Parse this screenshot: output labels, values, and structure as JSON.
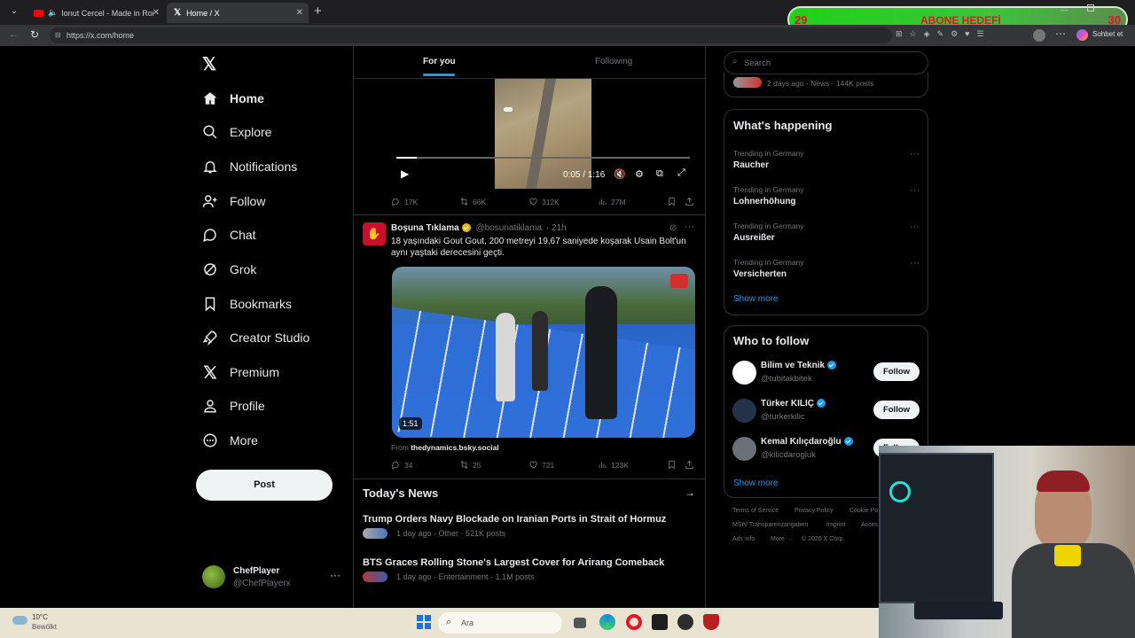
{
  "browser": {
    "tabs": [
      {
        "title": "Ionut Cercel - Made in Roman"
      },
      {
        "title": "Home / X"
      }
    ],
    "url": "https://x.com/home"
  },
  "overlay": {
    "count_left": "29",
    "title": "ABONE HEDEFİ",
    "count_right": "30",
    "chat_label": "Sohbet et"
  },
  "sidebar": {
    "items": [
      {
        "label": "Home",
        "icon": "home-icon"
      },
      {
        "label": "Explore",
        "icon": "search-icon"
      },
      {
        "label": "Notifications",
        "icon": "bell-icon"
      },
      {
        "label": "Follow",
        "icon": "person-plus-icon"
      },
      {
        "label": "Chat",
        "icon": "chat-icon"
      },
      {
        "label": "Grok",
        "icon": "grok-icon"
      },
      {
        "label": "Bookmarks",
        "icon": "bookmark-icon"
      },
      {
        "label": "Creator Studio",
        "icon": "rocket-icon"
      },
      {
        "label": "Premium",
        "icon": "x-logo-icon"
      },
      {
        "label": "Profile",
        "icon": "person-icon"
      },
      {
        "label": "More",
        "icon": "more-circle-icon"
      }
    ],
    "post_label": "Post",
    "account": {
      "name": "ChefPlayer",
      "handle": "@ChefPlayerx"
    }
  },
  "timeline": {
    "tabs": [
      "For you",
      "Following"
    ],
    "video1": {
      "time": "0:05 / 1:16"
    },
    "tweet1_stats": {
      "replies": "17K",
      "reposts": "66K",
      "likes": "312K",
      "views": "27M"
    },
    "tweet2": {
      "name": "Boşuna Tıklama",
      "handle": "@bosunatiklama",
      "time": "· 21h",
      "text": "18 yaşındaki Gout Gout, 200 metreyi 19,67 saniyede koşarak Usain Bolt'un aynı yaştaki derecesini geçti.",
      "duration": "1:51",
      "source_prefix": "From",
      "source": "thedynamics.bsky.social",
      "stats": {
        "replies": "34",
        "reposts": "25",
        "likes": "721",
        "views": "123K"
      }
    },
    "news": {
      "heading": "Today's News",
      "items": [
        {
          "title": "Trump Orders Navy Blockade on Iranian Ports in Strait of Hormuz",
          "meta": "1 day ago · Other · 521K posts"
        },
        {
          "title": "BTS Graces Rolling Stone's Largest Cover for Arirang Comeback",
          "meta": "1 day ago · Entertainment · 1.1M posts"
        }
      ]
    }
  },
  "right": {
    "search_placeholder": "Search",
    "top_meta": "2 days ago · News · 144K posts",
    "happening": {
      "title": "What's happening",
      "trends": [
        {
          "meta": "Trending in Germany",
          "name": "Raucher"
        },
        {
          "meta": "Trending in Germany",
          "name": "Lohnerhöhung"
        },
        {
          "meta": "Trending in Germany",
          "name": "Ausreißer"
        },
        {
          "meta": "Trending in Germany",
          "name": "Versicherten"
        }
      ],
      "show_more": "Show more"
    },
    "who_to_follow": {
      "title": "Who to follow",
      "accounts": [
        {
          "name": "Bilim ve Teknik",
          "handle": "@tubitakbitek",
          "button": "Follow"
        },
        {
          "name": "Türker KILIÇ",
          "handle": "@turkerkilic",
          "button": "Follow"
        },
        {
          "name": "Kemal Kılıçdaroğlu",
          "handle": "@kilicdarogluk",
          "button": "Follow"
        }
      ],
      "show_more": "Show more"
    },
    "footer": {
      "links": [
        "Terms of Service",
        "Privacy Policy",
        "Cookie Po",
        "MStV Transparenzangaben",
        "Imprint",
        "Acces",
        "Ads info",
        "More ···",
        "© 2026 X Corp."
      ]
    }
  },
  "taskbar": {
    "weather_temp": "10°C",
    "weather_desc": "Bewölkt",
    "search_placeholder": "Ara"
  },
  "colors": {
    "accent": "#1d9bf0",
    "overlay_green": "#22c31b",
    "overlay_red": "#e0162b"
  }
}
